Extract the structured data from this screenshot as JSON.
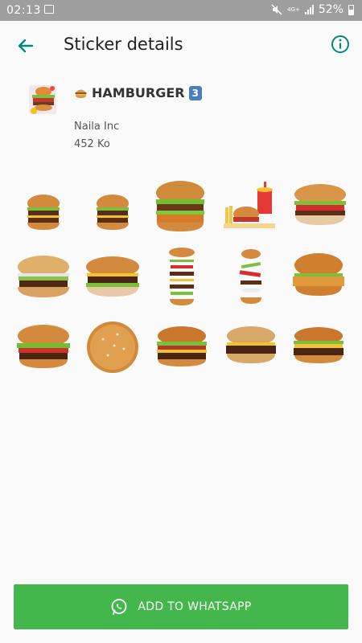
{
  "status_bar": {
    "time": "02:13",
    "network": "4G+",
    "battery": "52%",
    "icons": [
      "gallery-icon",
      "mute-icon",
      "network-icon",
      "signal-icon",
      "battery-icon"
    ]
  },
  "app_bar": {
    "title": "Sticker details",
    "back_icon": "arrow-back-icon",
    "info_icon": "info-icon"
  },
  "pack": {
    "name": "HAMBURGER",
    "badge": "3",
    "emoji_icon": "hamburger-emoji-icon",
    "publisher": "Naila Inc",
    "size": "452 Ko"
  },
  "stickers": [
    {
      "name": "double-burger-small"
    },
    {
      "name": "double-burger-small-2"
    },
    {
      "name": "chicken-burger"
    },
    {
      "name": "burger-fries-drink-meal"
    },
    {
      "name": "tomato-burger"
    },
    {
      "name": "classic-cheeseburger"
    },
    {
      "name": "lettuce-beef-burger"
    },
    {
      "name": "exploded-burger-tall"
    },
    {
      "name": "floating-burger-ingredients"
    },
    {
      "name": "crispy-chicken-burger"
    },
    {
      "name": "big-lettuce-burger"
    },
    {
      "name": "sesame-bun-top-view"
    },
    {
      "name": "bacon-cheeseburger"
    },
    {
      "name": "cheese-beef-burger"
    },
    {
      "name": "steak-burger"
    }
  ],
  "add_button": {
    "label": "ADD TO WHATSAPP",
    "icon": "whatsapp-icon"
  },
  "colors": {
    "accent": "#00897b",
    "button": "#43b74c",
    "status_bar": "#9e9e9e"
  }
}
